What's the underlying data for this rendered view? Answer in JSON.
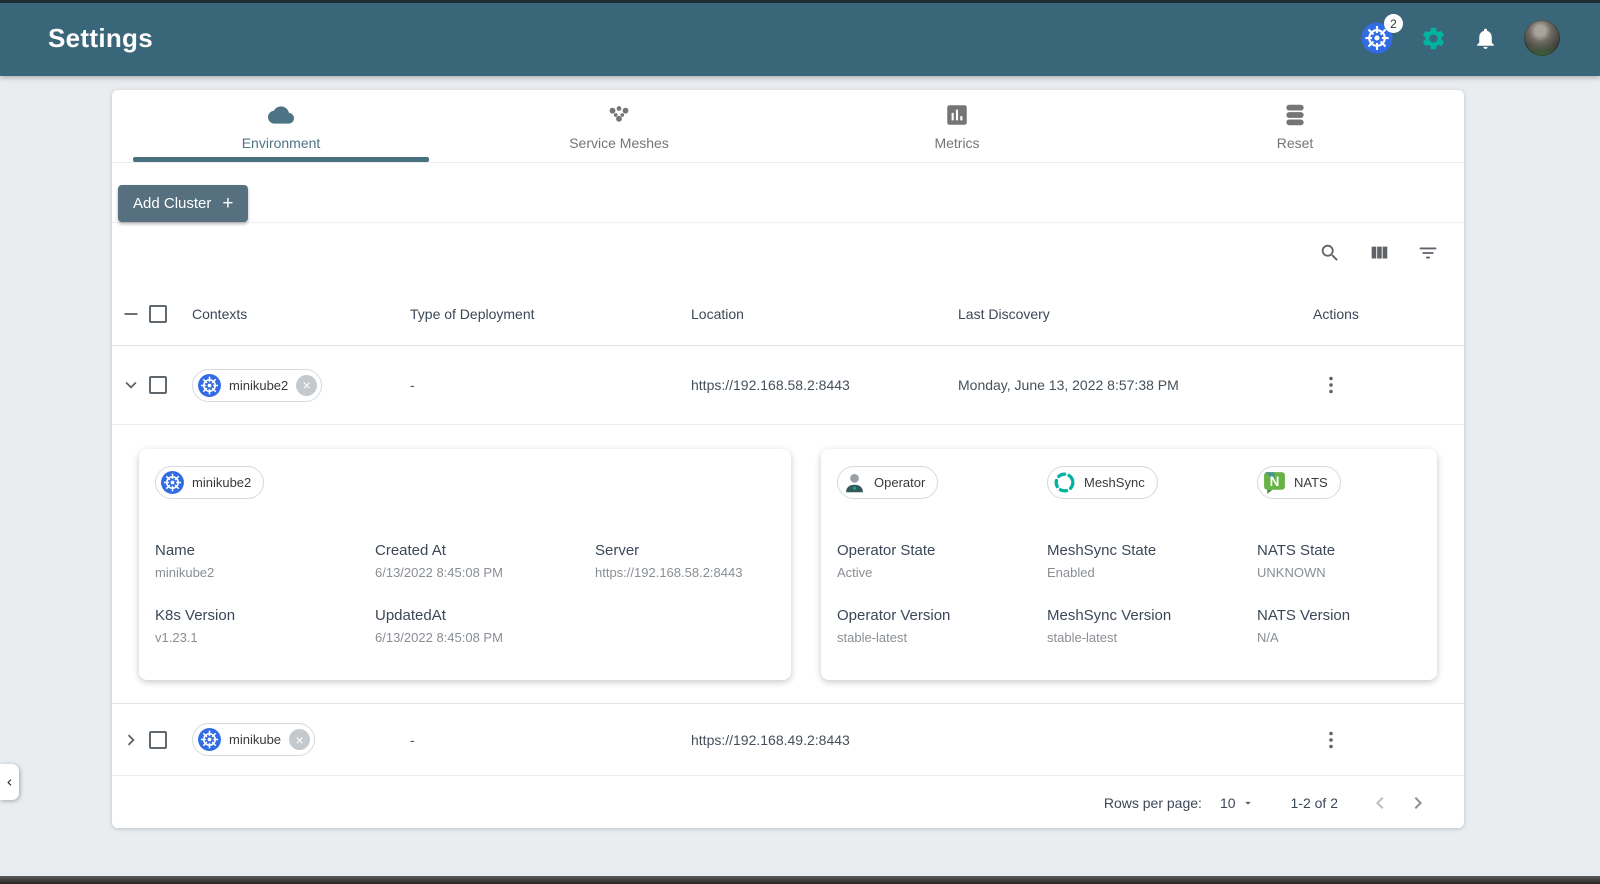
{
  "header": {
    "title": "Settings",
    "kubernetes_badge_count": "2"
  },
  "tabs": [
    {
      "label": "Environment",
      "icon": "cloud-icon",
      "active": true
    },
    {
      "label": "Service Meshes",
      "icon": "mesh-dots-icon",
      "active": false
    },
    {
      "label": "Metrics",
      "icon": "bar-chart-icon",
      "active": false
    },
    {
      "label": "Reset",
      "icon": "database-icon",
      "active": false
    }
  ],
  "actions_bar": {
    "add_cluster_label": "Add Cluster",
    "plus": "+"
  },
  "table": {
    "columns": [
      "Contexts",
      "Type of Deployment",
      "Location",
      "Last Discovery",
      "Actions"
    ],
    "rows": [
      {
        "context": "minikube2",
        "type_of_deployment": "-",
        "location": "https://192.168.58.2:8443",
        "last_discovery": "Monday, June 13, 2022 8:57:38 PM",
        "expanded": true
      },
      {
        "context": "minikube",
        "type_of_deployment": "-",
        "location": "https://192.168.49.2:8443",
        "last_discovery": "",
        "expanded": false
      }
    ]
  },
  "details": {
    "cluster": {
      "chip_label": "minikube2",
      "fields": [
        {
          "label": "Name",
          "value": "minikube2"
        },
        {
          "label": "Created At",
          "value": "6/13/2022 8:45:08 PM"
        },
        {
          "label": "Server",
          "value": "https://192.168.58.2:8443"
        },
        {
          "label": "K8s Version",
          "value": "v1.23.1"
        },
        {
          "label": "UpdatedAt",
          "value": "6/13/2022 8:45:08 PM"
        }
      ]
    },
    "operator": {
      "chips": [
        {
          "label": "Operator",
          "icon": "operator-person-icon"
        },
        {
          "label": "MeshSync",
          "icon": "meshsync-dashed-circle-icon"
        },
        {
          "label": "NATS",
          "icon": "nats-logo-icon"
        }
      ],
      "fields": [
        {
          "label": "Operator State",
          "value": "Active"
        },
        {
          "label": "MeshSync State",
          "value": "Enabled"
        },
        {
          "label": "NATS State",
          "value": "UNKNOWN"
        },
        {
          "label": "Operator Version",
          "value": "stable-latest"
        },
        {
          "label": "MeshSync Version",
          "value": "stable-latest"
        },
        {
          "label": "NATS Version",
          "value": "N/A"
        }
      ]
    }
  },
  "pagination": {
    "rows_per_page_label": "Rows per page:",
    "rows_per_page_value": "10",
    "range_label": "1-2 of 2"
  },
  "icons": {
    "kubernetes": "kubernetes-wheel",
    "gear": "settings-gear",
    "bell": "notification-bell",
    "search": "magnifier",
    "columns": "view-columns",
    "filter": "filter-list",
    "kebab": "three-dot-menu",
    "row_expanded": "chevron-down",
    "row_collapsed": "chevron-right",
    "chip_remove": "circle-x",
    "drawer": "chevron-left",
    "select_all": "indeterminate-minus"
  },
  "colors": {
    "app_bar": "#396679",
    "accent_green": "#00b39f",
    "kubernetes_blue": "#326ce5",
    "button_slate": "#56707f",
    "tab_indicator": "#47717f",
    "nats_green": "#67b346"
  }
}
